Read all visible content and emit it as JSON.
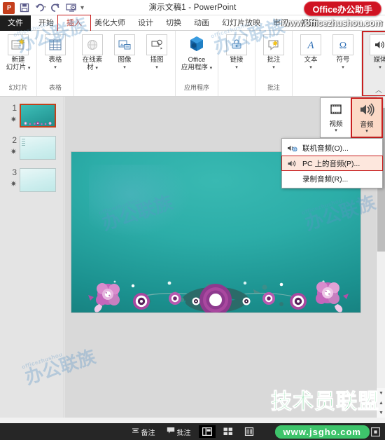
{
  "window": {
    "title": "演示文稿1 - PowerPoint",
    "app_icon": "powerpoint-logo-icon"
  },
  "quick_access": [
    {
      "name": "save-icon",
      "label": "保存"
    },
    {
      "name": "undo-icon",
      "label": "撤消"
    },
    {
      "name": "redo-icon",
      "label": "重复"
    },
    {
      "name": "start-slideshow-icon",
      "label": "从头开始"
    },
    {
      "name": "customize-qat-icon",
      "label": "自定义快速访问工具栏"
    }
  ],
  "tabs": {
    "file": "文件",
    "items": [
      {
        "label": "开始",
        "selected": false
      },
      {
        "label": "插入",
        "selected": true
      },
      {
        "label": "美化大师",
        "selected": false
      },
      {
        "label": "设计",
        "selected": false
      },
      {
        "label": "切换",
        "selected": false
      },
      {
        "label": "动画",
        "selected": false
      },
      {
        "label": "幻灯片放映",
        "selected": false
      },
      {
        "label": "审阅",
        "selected": false
      },
      {
        "label": "视图",
        "selected": false
      }
    ],
    "overflow": "▸"
  },
  "ribbon": {
    "groups": [
      {
        "label": "幻灯片",
        "buttons": [
          {
            "label": "新建\n幻灯片",
            "icon": "new-slide-icon",
            "caret": true
          }
        ]
      },
      {
        "label": "表格",
        "buttons": [
          {
            "label": "表格",
            "icon": "table-icon",
            "caret": true
          }
        ]
      },
      {
        "label": "",
        "buttons": [
          {
            "label": "在线素\n材",
            "icon": "online-material-icon",
            "caret": true
          },
          {
            "label": "图像",
            "icon": "images-icon",
            "caret": true
          },
          {
            "label": "插图",
            "icon": "illustrations-icon",
            "caret": true
          }
        ]
      },
      {
        "label": "应用程序",
        "buttons": [
          {
            "label": "Office\n应用程序",
            "icon": "office-apps-icon",
            "caret": true
          }
        ]
      },
      {
        "label": "",
        "buttons": [
          {
            "label": "链接",
            "icon": "link-icon",
            "caret": true
          }
        ]
      },
      {
        "label": "批注",
        "buttons": [
          {
            "label": "批注",
            "icon": "comment-icon",
            "caret": true
          }
        ]
      },
      {
        "label": "",
        "buttons": [
          {
            "label": "文本",
            "icon": "text-icon",
            "caret": true
          },
          {
            "label": "符号",
            "icon": "symbol-icon",
            "caret": true
          }
        ]
      },
      {
        "label": "",
        "highlighted": true,
        "buttons": [
          {
            "label": "媒体",
            "icon": "media-speaker-icon",
            "caret": true
          }
        ]
      }
    ],
    "collapse_label": "︿"
  },
  "media_panel": {
    "buttons": [
      {
        "label": "视频",
        "icon": "video-film-icon",
        "active": false,
        "highlighted": false
      },
      {
        "label": "音频",
        "icon": "audio-speaker-icon",
        "active": true,
        "highlighted": true
      }
    ]
  },
  "audio_menu": {
    "items": [
      {
        "label": "联机音频(O)...",
        "accel": "O",
        "icon": "online-audio-icon",
        "highlighted": false
      },
      {
        "label": "PC 上的音频(P)...",
        "accel": "P",
        "icon": "pc-audio-icon",
        "highlighted": true
      },
      {
        "label": "录制音频(R)...",
        "accel": "R",
        "icon": "record-audio-icon",
        "highlighted": false
      }
    ]
  },
  "slides_pane": {
    "thumbnails": [
      {
        "number": "1",
        "star": "✷",
        "selected": true
      },
      {
        "number": "2",
        "star": "✷",
        "selected": false
      },
      {
        "number": "3",
        "star": "✷",
        "selected": false
      }
    ]
  },
  "slide": {
    "background_top": "#39b9b2",
    "background_bottom": "#17807f",
    "decoration": "floral-border-decoration",
    "flower_colors": [
      "#8e3f8e",
      "#b055a8",
      "#d08ec8",
      "#ffffff",
      "#2e6f6d",
      "#3c8f8b"
    ]
  },
  "scrollbar": {
    "up_arrow": "▲",
    "down_arrow": "▼",
    "prev_slide": "▲",
    "next_slide": "▼"
  },
  "status_bar": {
    "notes": "备注",
    "comments": "批注",
    "views": [
      {
        "name": "normal-view",
        "icon": "normal-view-icon",
        "active": true
      },
      {
        "name": "slide-sorter-view",
        "icon": "slide-sorter-icon",
        "active": false
      },
      {
        "name": "reading-view",
        "icon": "reading-view-icon",
        "active": false
      }
    ],
    "fit_icon": "fit-slide-to-window-icon"
  },
  "watermarks": {
    "office_badge": "Office办公助手",
    "office_url": "www.officezhushou.com",
    "jsgho_cn": "技术员联盟",
    "jsgho_url": "www.jsgho.com",
    "diagonal_small": "officezhushou",
    "diagonal_big": "办公联族"
  },
  "colors": {
    "accent_red": "#c81f1f",
    "office_badge_red": "#cf1322",
    "jsgho_green": "#3ec46b",
    "slide_teal": "#2cada8",
    "selection_orange": "#c0421c"
  }
}
